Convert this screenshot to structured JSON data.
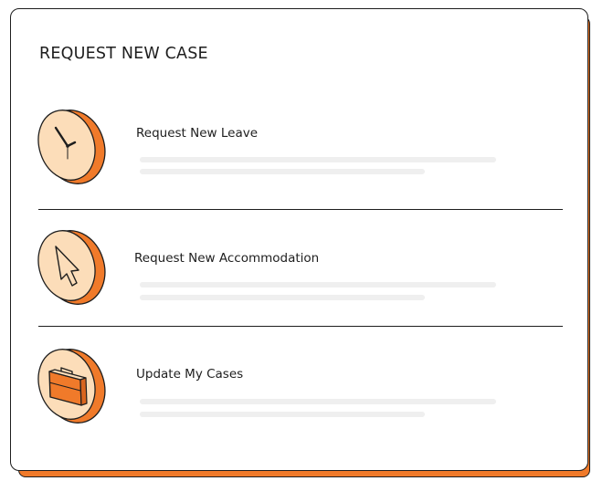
{
  "card": {
    "title": "REQUEST NEW CASE"
  },
  "items": [
    {
      "label": "Request New Leave",
      "icon": "clock-icon"
    },
    {
      "label": "Request New Accommodation",
      "icon": "cursor-arrow-icon"
    },
    {
      "label": "Update My Cases",
      "icon": "briefcase-icon"
    }
  ],
  "colors": {
    "accent": "#F07A2A",
    "accent_light": "#FCDDB9",
    "outline": "#1E1E1E",
    "placeholder": "#EFEFEF"
  }
}
